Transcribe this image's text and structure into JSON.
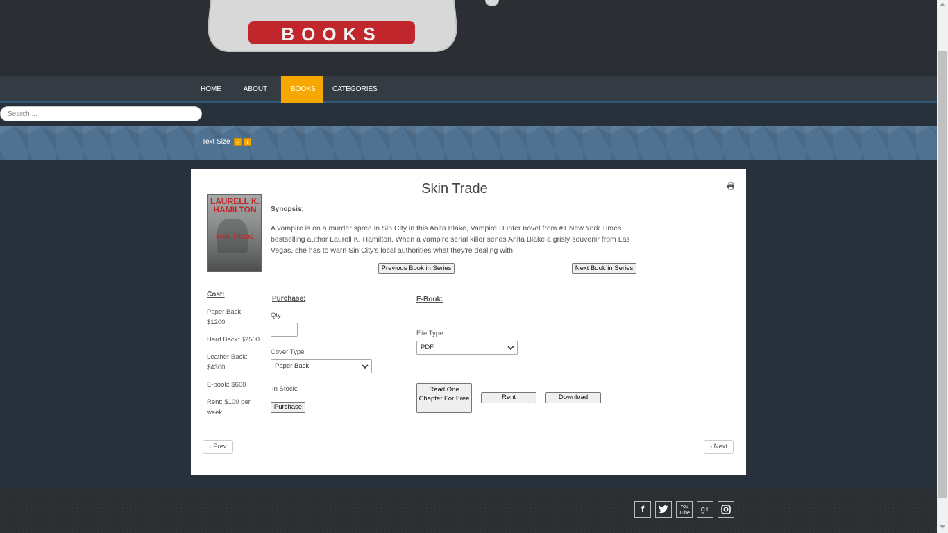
{
  "logo": {
    "text": "BOOKS"
  },
  "nav": {
    "items": [
      {
        "label": "HOME"
      },
      {
        "label": "ABOUT US"
      },
      {
        "label": "BOOKS"
      },
      {
        "label": "CATEGORIES"
      }
    ]
  },
  "search": {
    "placeholder": "Search ..."
  },
  "text_size": {
    "label": "Text Size",
    "decrease": "-",
    "increase": "+"
  },
  "book": {
    "title": "Skin Trade",
    "cover": {
      "author": "LAURELL K. HAMILTON",
      "title": "SKIN TRADE"
    },
    "synopsis_label": "Synopsis:",
    "synopsis": "A vampire is on a murder spree in Sin City in this Anita Blake, Vampire Hunter novel from #1 New York Times bestselling author Laurell K. Hamilton. When a vampire serial killer sends Anita Blake a grisly souvenir from Las Vegas, she has to warn Sin City's local authorities what they're dealing with.",
    "prev_series": "Previous Book in Series",
    "next_series": "Next Book in Series"
  },
  "cost": {
    "label": "Cost:",
    "items": [
      "Paper Back: $1200",
      "Hard Back: $2500",
      "Leather Back: $4300",
      "E-book: $600",
      "Rent: $100 per week"
    ]
  },
  "purchase": {
    "label": "Purchase:",
    "qty_label": "Qty:",
    "qty_value": "",
    "cover_type_label": "Cover Type:",
    "cover_type_value": "Paper Back",
    "in_stock_label": "In Stock:",
    "button": "Purchase"
  },
  "ebook": {
    "label": "E-Book:",
    "file_type_label": "File Type:",
    "file_type_value": "PDF",
    "read_chapter": "Read One Chapter For Free",
    "rent": "Rent",
    "download": "Download"
  },
  "pager": {
    "prev": "Prev",
    "next": "Next"
  },
  "social": [
    "f",
    "t",
    "You Tube",
    "g+",
    "instagram"
  ],
  "colors": {
    "accent": "#f6a800",
    "header": "#2b2f33",
    "background": "#26313b"
  }
}
